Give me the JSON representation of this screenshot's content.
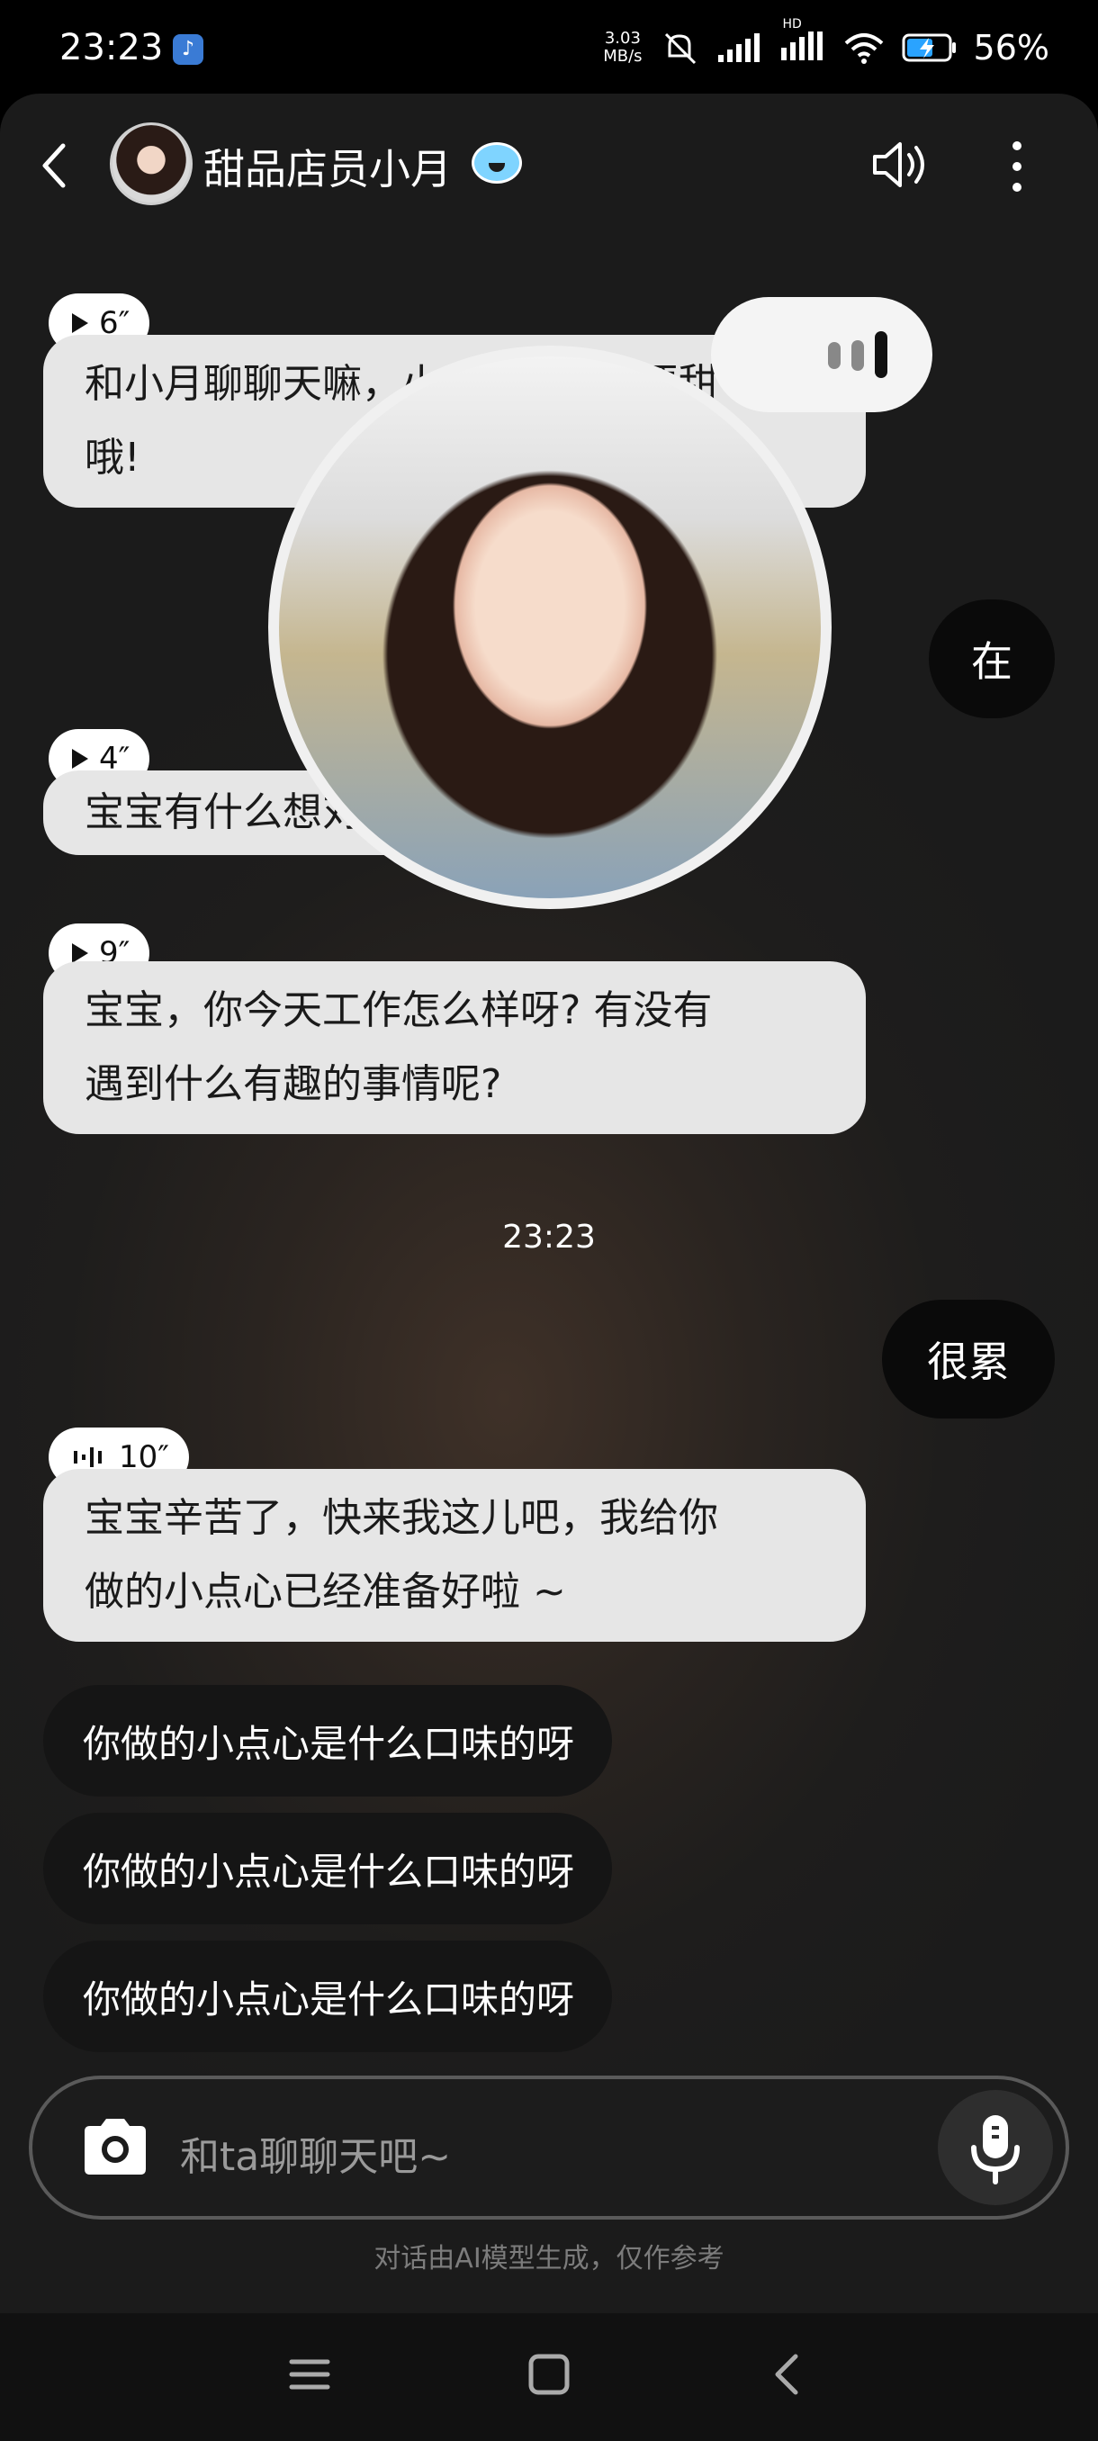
{
  "status_bar": {
    "time": "23:23",
    "app_icon": "douyin-icon",
    "speed_value": "3.03",
    "speed_unit": "MB/s",
    "hd_label": "HD",
    "battery": "56%"
  },
  "header": {
    "name": "甜品店员小月",
    "back_icon": "back-chevron-icon",
    "speaker_icon": "speaker-icon",
    "more_icon": "more-vertical-icon"
  },
  "messages": [
    {
      "role": "ai",
      "duration": "6″",
      "text_line1": "和小月聊聊天嘛，小月比蛋糕还要甜",
      "text_line2": "哦!"
    },
    {
      "role": "me",
      "text": "在"
    },
    {
      "role": "ai",
      "duration": "4″",
      "text_line1": "宝宝有什么想对小月说的吗?"
    },
    {
      "role": "ai",
      "duration": "9″",
      "text_line1": "宝宝，你今天工作怎么样呀? 有没有",
      "text_line2": "遇到什么有趣的事情呢?"
    },
    {
      "role": "me",
      "text": "很累"
    },
    {
      "role": "ai",
      "duration": "10″",
      "text_line1": "宝宝辛苦了，快来我这儿吧，我给你",
      "text_line2": "做的小点心已经准备好啦 ~"
    }
  ],
  "timestamp": "23:23",
  "suggestions": [
    "你做的小点心是什么口味的呀",
    "你做的小点心是什么口味的呀",
    "你做的小点心是什么口味的呀"
  ],
  "input": {
    "placeholder": "和ta聊聊天吧~",
    "camera_icon": "camera-icon",
    "mic_icon": "microphone-icon"
  },
  "disclaimer": "对话由AI模型生成，仅作参考",
  "nav": {
    "menu_icon": "menu-icon",
    "home_icon": "home-square-icon",
    "back_icon": "back-triangle-icon"
  }
}
